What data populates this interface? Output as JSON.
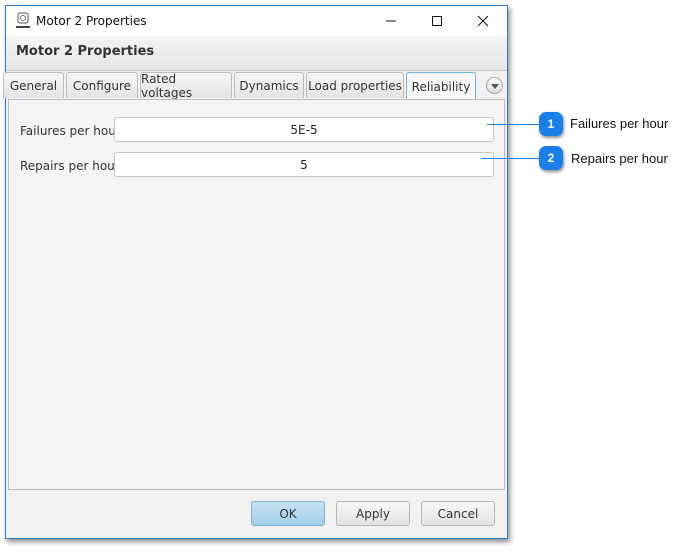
{
  "window": {
    "title": "Motor 2 Properties",
    "controls": {
      "minimize": "minimize-icon",
      "maximize": "maximize-icon",
      "close": "close-icon"
    }
  },
  "header": {
    "title": "Motor 2 Properties"
  },
  "tabs": [
    {
      "label": "General",
      "active": false
    },
    {
      "label": "Configure",
      "active": false
    },
    {
      "label": "Rated voltages",
      "active": false
    },
    {
      "label": "Dynamics",
      "active": false
    },
    {
      "label": "Load properties",
      "active": false
    },
    {
      "label": "Reliability",
      "active": true
    }
  ],
  "fields": [
    {
      "label": "Failures per hour",
      "value": "5E-5"
    },
    {
      "label": "Repairs per hour",
      "value": "5"
    }
  ],
  "buttons": {
    "ok": "OK",
    "apply": "Apply",
    "cancel": "Cancel"
  },
  "callouts": [
    {
      "number": "1",
      "text": "Failures per hour"
    },
    {
      "number": "2",
      "text": "Repairs per hour"
    }
  ],
  "colors": {
    "accent": "#1a7fe8",
    "window_border": "#2a7bc8",
    "ok_button": "#b3d8ef"
  }
}
